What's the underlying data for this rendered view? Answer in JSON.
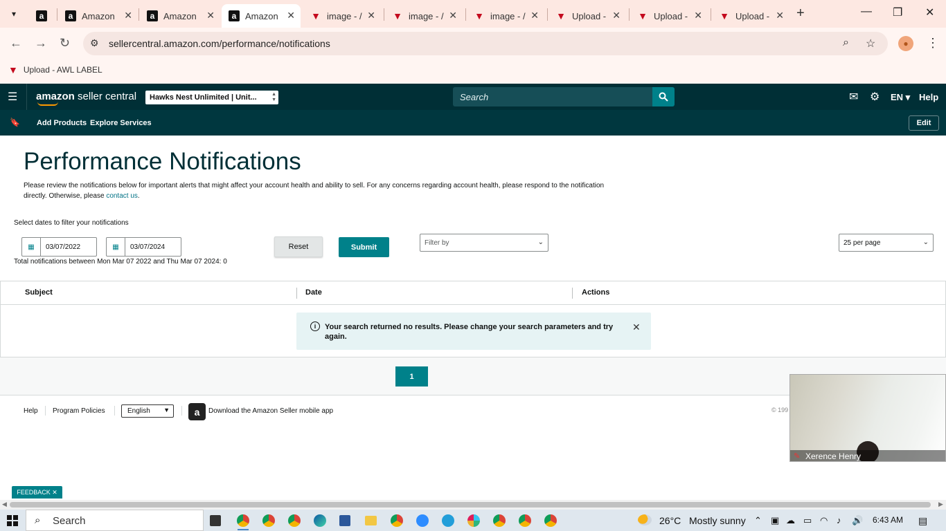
{
  "browser": {
    "tabs": [
      {
        "title": "",
        "favicon": "amazon"
      },
      {
        "title": "Amazon",
        "favicon": "amazon"
      },
      {
        "title": "Amazon",
        "favicon": "amazon"
      },
      {
        "title": "Amazon",
        "favicon": "amazon",
        "active": true
      },
      {
        "title": "image - /",
        "favicon": "awl"
      },
      {
        "title": "image - /",
        "favicon": "awl"
      },
      {
        "title": "image - /",
        "favicon": "awl"
      },
      {
        "title": "Upload -",
        "favicon": "awl"
      },
      {
        "title": "Upload -",
        "favicon": "awl"
      },
      {
        "title": "Upload -",
        "favicon": "awl"
      }
    ],
    "url": "sellercentral.amazon.com/performance/notifications",
    "bookmark": "Upload - AWL LABEL"
  },
  "header": {
    "logo_amazon": "amazon",
    "logo_rest": " seller central",
    "account": "Hawks Nest Unlimited | Unit...",
    "search_placeholder": "Search",
    "lang": "EN",
    "help": "Help"
  },
  "subnav": {
    "add_products": "Add Products",
    "explore_services": "Explore Services",
    "edit": "Edit"
  },
  "page": {
    "title": "Performance Notifications",
    "intro_text": "Please review the notifications below for important alerts that might affect your account health and ability to sell. For any concerns regarding account health, please respond to the notification directly. Otherwise, please ",
    "intro_link": "contact us",
    "intro_end": ".",
    "filter_label": "Select dates to filter your notifications",
    "start_date": "03/07/2022",
    "end_date": "03/07/2024",
    "reset": "Reset",
    "submit": "Submit",
    "filter_by": "Filter by",
    "per_page": "25 per page",
    "totals": "Total notifications between Mon Mar 07 2022 and Thu Mar 07 2024: 0"
  },
  "table": {
    "columns": [
      "Subject",
      "Date",
      "Actions"
    ],
    "empty_message": "Your search returned no results. Please change your search parameters and try again.",
    "current_page": "1"
  },
  "footer": {
    "help": "Help",
    "program_policies": "Program Policies",
    "language": "English",
    "app_text": "Download the Amazon Seller mobile app",
    "copyright": "© 199"
  },
  "video": {
    "name": "Xerence Henry"
  },
  "feedback": "FEEDBACK",
  "taskbar": {
    "search": "Search",
    "temperature": "26°C",
    "weather": "Mostly sunny",
    "time": "6:43 AM"
  },
  "colors": {
    "accent": "#00818a",
    "header": "#002f36",
    "tabstrip": "#fde8e2"
  }
}
